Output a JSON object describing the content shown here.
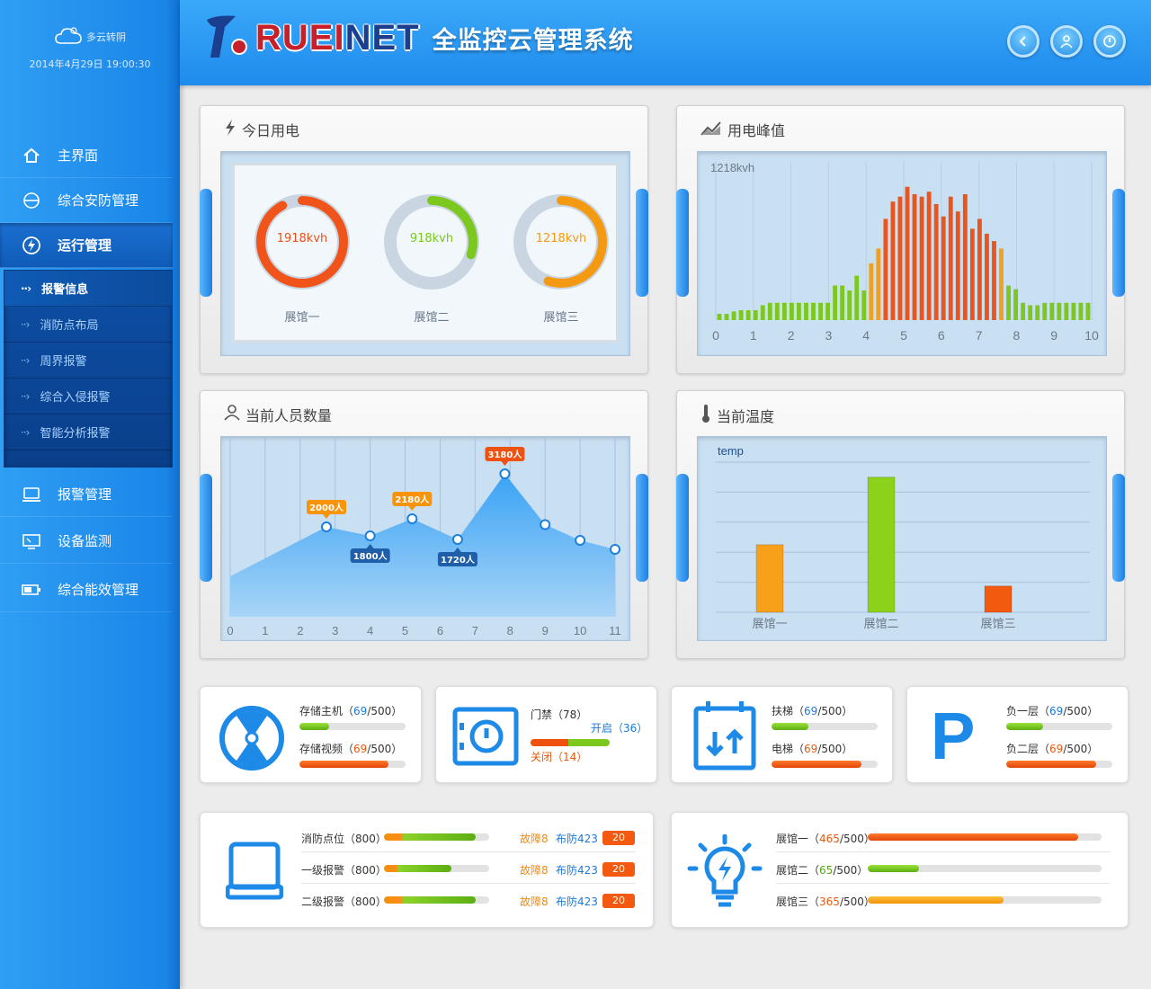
{
  "sidebar": {
    "weather": "多云转阴",
    "datetime": "2014年4月29日 19:00:30",
    "items": [
      {
        "label": "主界面"
      },
      {
        "label": "综合安防管理"
      },
      {
        "label": "运行管理"
      },
      {
        "label": "报警管理"
      },
      {
        "label": "设备监测"
      },
      {
        "label": "综合能效管理"
      }
    ],
    "sub_items": [
      {
        "label": "报警信息"
      },
      {
        "label": "消防点布局"
      },
      {
        "label": "周界报警"
      },
      {
        "label": "综合入侵报警"
      },
      {
        "label": "智能分析报警"
      }
    ]
  },
  "header": {
    "logo_red": "RUEI",
    "logo_blue": "NET",
    "title": "全监控云管理系统"
  },
  "panels": {
    "power_today": {
      "title": "今日用电",
      "gauges": [
        {
          "value": "1918kvh",
          "label": "展馆一",
          "fraction": 0.92,
          "color": "#f0541a"
        },
        {
          "value": "918kvh",
          "label": "展馆二",
          "fraction": 0.3,
          "color": "#7cc81e"
        },
        {
          "value": "1218kvh",
          "label": "展馆三",
          "fraction": 0.55,
          "color": "#f49a12"
        }
      ]
    },
    "power_peak": {
      "title": "用电峰值"
    },
    "people": {
      "title": "当前人员数量"
    },
    "temperature": {
      "title": "当前温度"
    }
  },
  "chart_data": [
    {
      "type": "bar",
      "title": "用电峰值",
      "ylabel": "1218kvh",
      "x_ticks": [
        "0",
        "1",
        "2",
        "3",
        "4",
        "5",
        "6",
        "7",
        "8",
        "9",
        "10"
      ],
      "xlim": [
        0,
        10
      ],
      "values": [
        5,
        5,
        7,
        8,
        8,
        8,
        12,
        14,
        14,
        14,
        14,
        14,
        14,
        14,
        14,
        14,
        28,
        28,
        24,
        36,
        24,
        46,
        58,
        82,
        96,
        100,
        108,
        102,
        100,
        104,
        94,
        84,
        100,
        88,
        102,
        74,
        82,
        70,
        64,
        58,
        28,
        25,
        14,
        12,
        12,
        14,
        14,
        14,
        14,
        14,
        14,
        14
      ],
      "colors_by_range": {
        "green": "#7cc81e",
        "amber": "#f0a020",
        "orange": "#e9551c"
      }
    },
    {
      "type": "area",
      "title": "当前人员数量",
      "x_ticks": [
        "0",
        "1",
        "2",
        "3",
        "4",
        "5",
        "6",
        "7",
        "8",
        "9",
        "10",
        "11"
      ],
      "points": [
        [
          0,
          900
        ],
        [
          2.75,
          2000
        ],
        [
          4,
          1800
        ],
        [
          5.2,
          2180
        ],
        [
          6.5,
          1720
        ],
        [
          7.85,
          3180
        ],
        [
          9,
          2050
        ],
        [
          10,
          1700
        ],
        [
          11,
          1500
        ]
      ],
      "callouts": [
        {
          "x": 2.75,
          "label": "2000人",
          "style": "orange-above"
        },
        {
          "x": 4,
          "label": "1800人",
          "style": "blue-below"
        },
        {
          "x": 5.2,
          "label": "2180人",
          "style": "orange-above"
        },
        {
          "x": 6.5,
          "label": "1720人",
          "style": "blue-below"
        },
        {
          "x": 7.85,
          "label": "3180人",
          "style": "red-above"
        }
      ]
    },
    {
      "type": "bar",
      "title": "当前温度",
      "series_label": "temp",
      "categories": [
        "展馆一",
        "展馆二",
        "展馆三"
      ],
      "values": [
        18,
        36,
        7
      ],
      "colors": [
        "#f8a019",
        "#8dd21a",
        "#f25a10"
      ]
    }
  ],
  "stats": {
    "storage": {
      "rows": [
        {
          "label": "存储主机",
          "open": "（",
          "value": "69",
          "max": "/500）",
          "fraction": 0.28,
          "color": "green"
        },
        {
          "label": "存储视频",
          "open": "（",
          "value": "69",
          "max": "/500）",
          "fraction": 0.84,
          "color": "orange"
        }
      ]
    },
    "door": {
      "label": "门禁（78）",
      "open_label": "开启（36）",
      "closed_label": "关闭（14）"
    },
    "elevator": {
      "rows": [
        {
          "label": "扶梯",
          "open": "（",
          "value": "69",
          "max": "/500）",
          "fraction": 0.35,
          "color": "green"
        },
        {
          "label": "电梯",
          "open": "（",
          "value": "69",
          "max": "/500）",
          "fraction": 0.85,
          "color": "orange"
        }
      ]
    },
    "parking": {
      "icon": "P",
      "rows": [
        {
          "label": "负一层",
          "open": "（",
          "value": "69",
          "max": "/500）",
          "fraction": 0.35,
          "color": "green"
        },
        {
          "label": "负二层",
          "open": "（",
          "value": "69",
          "max": "/500）",
          "fraction": 0.85,
          "color": "orange"
        }
      ]
    },
    "fire": {
      "rows": [
        {
          "label": "消防点位（800）",
          "fault": "故障8",
          "armed": "布防423",
          "count": "20",
          "fraction": 0.87
        },
        {
          "label": "一级报警（800）",
          "fault": "故障8",
          "armed": "布防423",
          "count": "20",
          "fraction": 0.64
        },
        {
          "label": "二级报警（800）",
          "fault": "故障8",
          "armed": "布防423",
          "count": "20",
          "fraction": 0.87
        }
      ]
    },
    "lighting": {
      "rows": [
        {
          "label": "展馆一",
          "open": "（",
          "value": "465",
          "max": "/500）",
          "fraction": 0.9,
          "color": "orange"
        },
        {
          "label": "展馆二",
          "open": "（",
          "value": "65",
          "max": "/500）",
          "fraction": 0.22,
          "color": "green"
        },
        {
          "label": "展馆三",
          "open": "（",
          "value": "365",
          "max": "/500）",
          "fraction": 0.58,
          "color": "amber"
        }
      ]
    }
  }
}
